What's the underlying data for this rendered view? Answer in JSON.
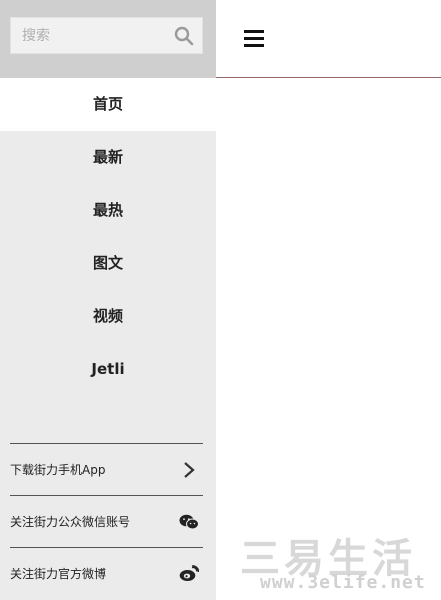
{
  "search": {
    "placeholder": "搜索"
  },
  "nav": {
    "items": [
      {
        "label": "首页",
        "active": true
      },
      {
        "label": "最新",
        "active": false
      },
      {
        "label": "最热",
        "active": false
      },
      {
        "label": "图文",
        "active": false
      },
      {
        "label": "视频",
        "active": false
      },
      {
        "label": "Jetli",
        "active": false
      }
    ]
  },
  "links": [
    {
      "label": "下载街力手机App",
      "icon": "chevron-right-icon"
    },
    {
      "label": "关注街力公众微信账号",
      "icon": "wechat-icon"
    },
    {
      "label": "关注街力官方微博",
      "icon": "weibo-icon"
    }
  ],
  "watermark": {
    "brand": "三易生活",
    "url": "www.3elife.net"
  },
  "colors": {
    "sidebar_bg": "#ebebeb",
    "search_bg": "#cfcfcf",
    "active_bg": "#ffffff",
    "header_border": "#9a6b6b"
  }
}
